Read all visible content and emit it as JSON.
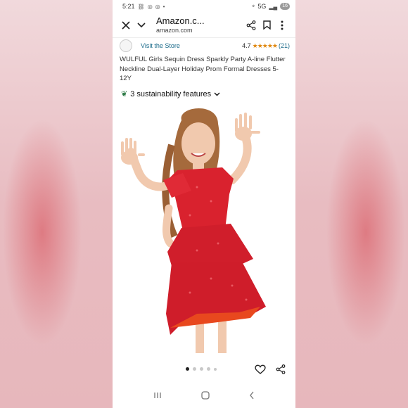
{
  "status_bar": {
    "time": "5:21",
    "icons_left": [
      "link-icon",
      "activity-icon",
      "activity-icon",
      "dot-icon"
    ],
    "network": "5G",
    "battery": "16"
  },
  "toolbar": {
    "title": "Amazon.c...",
    "subtitle": "amazon.com"
  },
  "store": {
    "visit_label": "Visit the Store",
    "rating_value": "4.7",
    "stars": "★★★★★",
    "review_count": "(21)"
  },
  "product": {
    "title": "WULFUL Girls Sequin Dress Sparkly Party A-line Flutter Neckline Dual-Layer Holiday Prom Formal Dresses 5-12Y"
  },
  "sustainability": {
    "label": "3 sustainability features"
  },
  "image_carousel": {
    "page_count": 5,
    "active_index": 0
  },
  "colors": {
    "dress_red": "#d9222e",
    "link_blue": "#1a6a8a",
    "star_orange": "#e08a14",
    "leaf_green": "#2d7a46"
  }
}
